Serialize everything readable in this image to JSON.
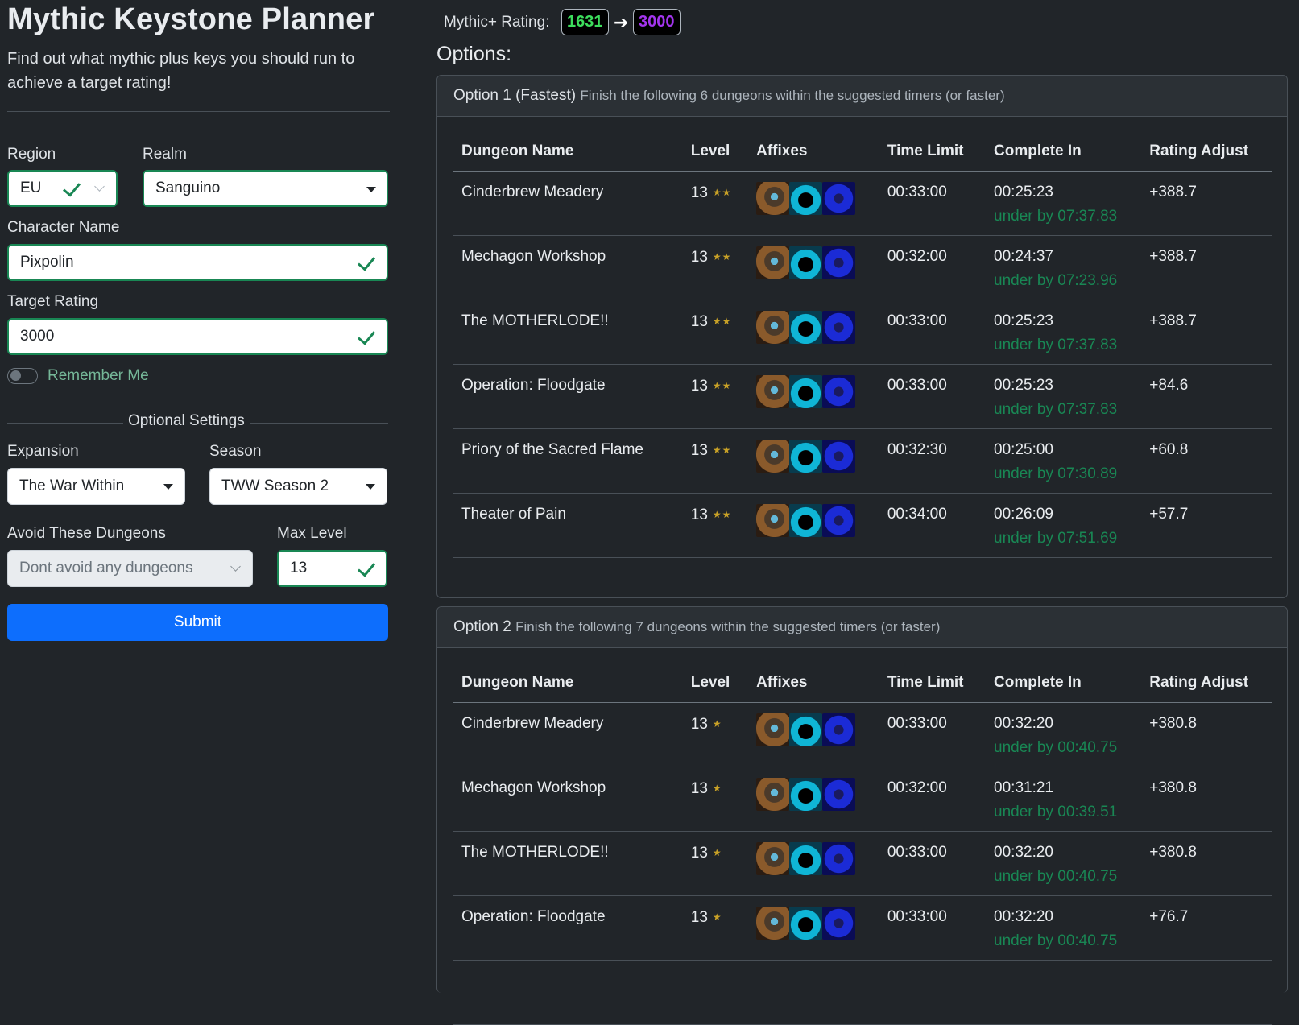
{
  "app": {
    "title": "Mythic Keystone Planner",
    "subtitle": "Find out what mythic plus keys you should run to achieve a target rating!"
  },
  "form": {
    "region_label": "Region",
    "region_value": "EU",
    "realm_label": "Realm",
    "realm_value": "Sanguino",
    "character_label": "Character Name",
    "character_value": "Pixpolin",
    "target_label": "Target Rating",
    "target_value": "3000",
    "remember_label": "Remember Me",
    "remember_on": false,
    "optional_label": "Optional Settings",
    "expansion_label": "Expansion",
    "expansion_value": "The War Within",
    "season_label": "Season",
    "season_value": "TWW Season 2",
    "avoid_label": "Avoid These Dungeons",
    "avoid_placeholder": "Dont avoid any dungeons",
    "maxlevel_label": "Max Level",
    "maxlevel_value": "13",
    "submit_label": "Submit"
  },
  "rating": {
    "label": "Mythic+ Rating:",
    "current": "1631",
    "current_color": "#3dde5c",
    "arrow_icon": "arrow-right-icon",
    "target": "3000",
    "target_color": "#a335ee"
  },
  "options_title": "Options:",
  "columns": [
    "Dungeon Name",
    "Level",
    "Affixes",
    "Time Limit",
    "Complete In",
    "Rating Adjust"
  ],
  "option1": {
    "title": "Option 1 (Fastest)",
    "description": "Finish the following 6 dungeons within the suggested timers (or faster)",
    "rows": [
      {
        "name": "Cinderbrew Meadery",
        "level": "13",
        "stars": "★★",
        "time_limit": "00:33:00",
        "complete": "00:25:23",
        "under": "under by 07:37.83",
        "adjust": "+388.7"
      },
      {
        "name": "Mechagon Workshop",
        "level": "13",
        "stars": "★★",
        "time_limit": "00:32:00",
        "complete": "00:24:37",
        "under": "under by 07:23.96",
        "adjust": "+388.7"
      },
      {
        "name": "The MOTHERLODE!!",
        "level": "13",
        "stars": "★★",
        "time_limit": "00:33:00",
        "complete": "00:25:23",
        "under": "under by 07:37.83",
        "adjust": "+388.7"
      },
      {
        "name": "Operation: Floodgate",
        "level": "13",
        "stars": "★★",
        "time_limit": "00:33:00",
        "complete": "00:25:23",
        "under": "under by 07:37.83",
        "adjust": "+84.6"
      },
      {
        "name": "Priory of the Sacred Flame",
        "level": "13",
        "stars": "★★",
        "time_limit": "00:32:30",
        "complete": "00:25:00",
        "under": "under by 07:30.89",
        "adjust": "+60.8"
      },
      {
        "name": "Theater of Pain",
        "level": "13",
        "stars": "★★",
        "time_limit": "00:34:00",
        "complete": "00:26:09",
        "under": "under by 07:51.69",
        "adjust": "+57.7"
      }
    ]
  },
  "option2": {
    "title": "Option 2",
    "description": "Finish the following 7 dungeons within the suggested timers (or faster)",
    "rows": [
      {
        "name": "Cinderbrew Meadery",
        "level": "13",
        "stars": "★",
        "time_limit": "00:33:00",
        "complete": "00:32:20",
        "under": "under by 00:40.75",
        "adjust": "+380.8"
      },
      {
        "name": "Mechagon Workshop",
        "level": "13",
        "stars": "★",
        "time_limit": "00:32:00",
        "complete": "00:31:21",
        "under": "under by 00:39.51",
        "adjust": "+380.8"
      },
      {
        "name": "The MOTHERLODE!!",
        "level": "13",
        "stars": "★",
        "time_limit": "00:33:00",
        "complete": "00:32:20",
        "under": "under by 00:40.75",
        "adjust": "+380.8"
      },
      {
        "name": "Operation: Floodgate",
        "level": "13",
        "stars": "★",
        "time_limit": "00:33:00",
        "complete": "00:32:20",
        "under": "under by 00:40.75",
        "adjust": "+76.7"
      },
      {
        "name": "",
        "level": "",
        "stars": "",
        "time_limit": "",
        "complete": "",
        "under": "",
        "adjust": ""
      }
    ]
  },
  "affix_icons": [
    "affix-xalatath-icon",
    "affix-afflicted-icon",
    "affix-void-icon"
  ]
}
